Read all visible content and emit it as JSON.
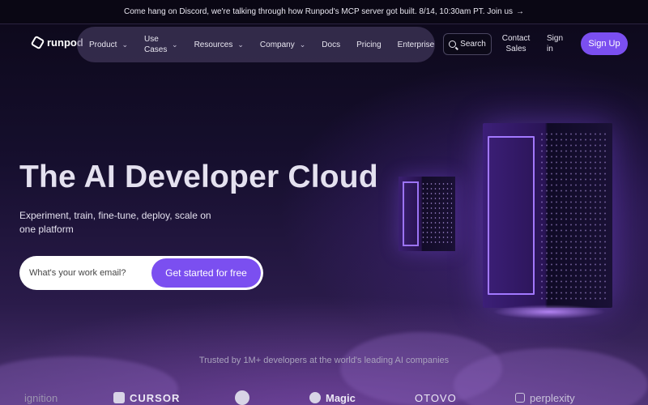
{
  "banner": {
    "text": "Come hang on Discord, we're talking through how Runpod's MCP server got built. 8/14, 10:30am PT. Join us",
    "arrow": "→"
  },
  "header": {
    "logo_text": "runpod",
    "nav": [
      {
        "label": "Product",
        "has_dropdown": true
      },
      {
        "label": "Use Cases",
        "has_dropdown": true
      },
      {
        "label": "Resources",
        "has_dropdown": true
      },
      {
        "label": "Company",
        "has_dropdown": true
      },
      {
        "label": "Docs",
        "has_dropdown": false
      },
      {
        "label": "Pricing",
        "has_dropdown": false
      },
      {
        "label": "Enterprise",
        "has_dropdown": false
      }
    ],
    "search_label": "Search",
    "contact_label": "Contact Sales",
    "signin_label": "Sign in",
    "signup_label": "Sign Up"
  },
  "hero": {
    "title": "The AI Developer Cloud",
    "subtitle": "Experiment, train, fine-tune, deploy, scale on one platform",
    "email_placeholder": "What's your work email?",
    "cta_label": "Get started for free"
  },
  "trusted": {
    "text": "Trusted by 1M+ developers at the world's leading AI companies",
    "logos": [
      "ignition",
      "CURSOR",
      "",
      "Magic",
      "OTOVO",
      "perplexity"
    ]
  },
  "colors": {
    "accent": "#7b4ff0",
    "banner_bg": "#0a0714",
    "page_bg": "#0f0a1f"
  }
}
